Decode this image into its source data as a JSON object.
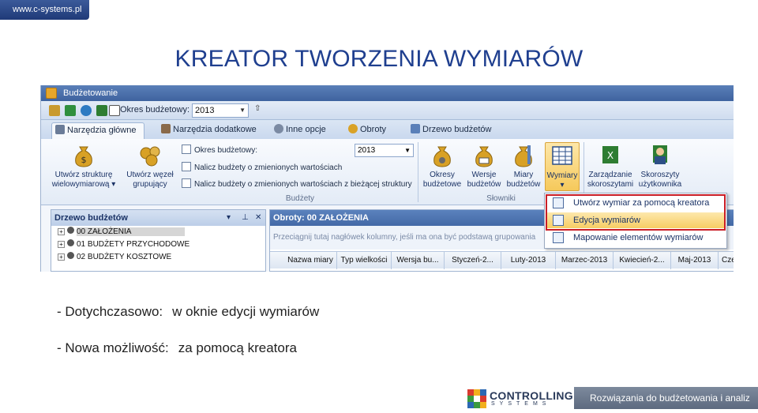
{
  "slide": {
    "url": "www.c-systems.pl",
    "title": "KREATOR TWORZENIA WYMIARÓW",
    "bullets": [
      [
        "- Dotychczasowo:",
        "w oknie edycji wymiarów"
      ],
      [
        "- Nowa możliwość:",
        "za pomocą kreatora"
      ]
    ],
    "logo_name": "CONTROLLING",
    "logo_sub": "SYSTEMS",
    "footer": "Rozwiązania do budżetowania i analiz"
  },
  "app": {
    "window_title": "Budżetowanie",
    "qat": {
      "label": "Okres budżetowy:",
      "value": "2013"
    },
    "tabs": [
      "Narzędzia główne",
      "Narzędzia dodatkowe",
      "Inne opcje",
      "Obroty",
      "Drzewo budżetów"
    ],
    "ribbon": {
      "btn_struktura": [
        "Utwórz strukturę",
        "wielowymiarową ▾"
      ],
      "btn_wezel": [
        "Utwórz węzeł",
        "grupujący"
      ],
      "okres_label": "Okres budżetowy:",
      "okres_value": "2013",
      "nalicz_1": "Nalicz budżety o zmienionych wartościach",
      "nalicz_2": "Nalicz budżety o zmienionych wartościach z bieżącej struktury",
      "group_budzety": "Budżety",
      "btn_okresy": [
        "Okresy",
        "budżetowe"
      ],
      "btn_wersje": [
        "Wersje",
        "budżetów"
      ],
      "btn_miary": [
        "Miary",
        "budżetów"
      ],
      "btn_wymiary": [
        "Wymiary",
        "▾"
      ],
      "group_slowniki": "Słowniki",
      "btn_zarzadzanie": [
        "Zarządzanie",
        "skoroszytami"
      ],
      "btn_skoroszyty": [
        "Skoroszyty",
        "użytkownika"
      ]
    },
    "tree": {
      "title": "Drzewo budżetów",
      "items": [
        "00 ZAŁOŻENIA",
        "01 BUDŻETY PRZYCHODOWE",
        "02 BUDŻETY KOSZTOWE"
      ]
    },
    "grid": {
      "title": "Obroty: 00 ZAŁOŻENIA",
      "group_hint": "Przeciągnij tutaj nagłówek kolumny, jeśli ma ona być podstawą grupowania",
      "columns": [
        "Nazwa miary",
        "Typ wielkości",
        "Wersja bu...",
        "Styczeń-2...",
        "Luty-2013",
        "Marzec-2013",
        "Kwiecień-2...",
        "Maj-2013",
        "Cze"
      ]
    },
    "menu": {
      "items": [
        "Utwórz wymiar za pomocą kreatora",
        "Edycja wymiarów",
        "Mapowanie elementów wymiarów"
      ]
    }
  }
}
